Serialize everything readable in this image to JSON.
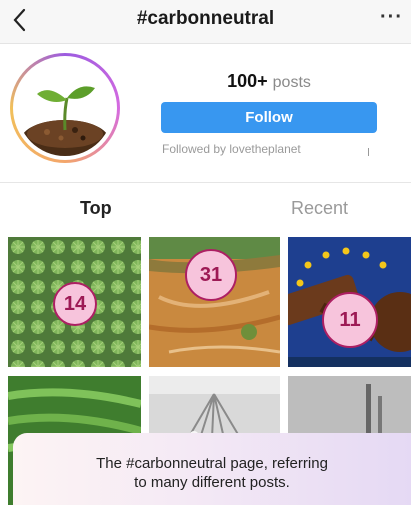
{
  "header": {
    "title": "#carbonneutral",
    "more_label": "···"
  },
  "profile": {
    "posts_count": "100+",
    "posts_label": "posts",
    "follow_label": "Follow",
    "followed_by": "Followed by lovetheplanet"
  },
  "tabs": [
    {
      "label": "Top"
    },
    {
      "label": "Recent"
    }
  ],
  "grid": [
    {
      "badge": "14",
      "subject": "palm plantation aerial"
    },
    {
      "badge": "31",
      "subject": "cleared land aerial"
    },
    {
      "badge": "11",
      "subject": "gavel with EU flag"
    },
    {
      "subject": "crop rows"
    },
    {
      "subject": "cotton field"
    },
    {
      "subject": "industrial smokestacks"
    }
  ],
  "caption": {
    "line1": "The #carbonneutral page, referring",
    "line2": "to many different posts."
  },
  "colors": {
    "follow": "#3897f0",
    "badge_fill": "#f7c4dc",
    "badge_border": "#ad1f63"
  }
}
